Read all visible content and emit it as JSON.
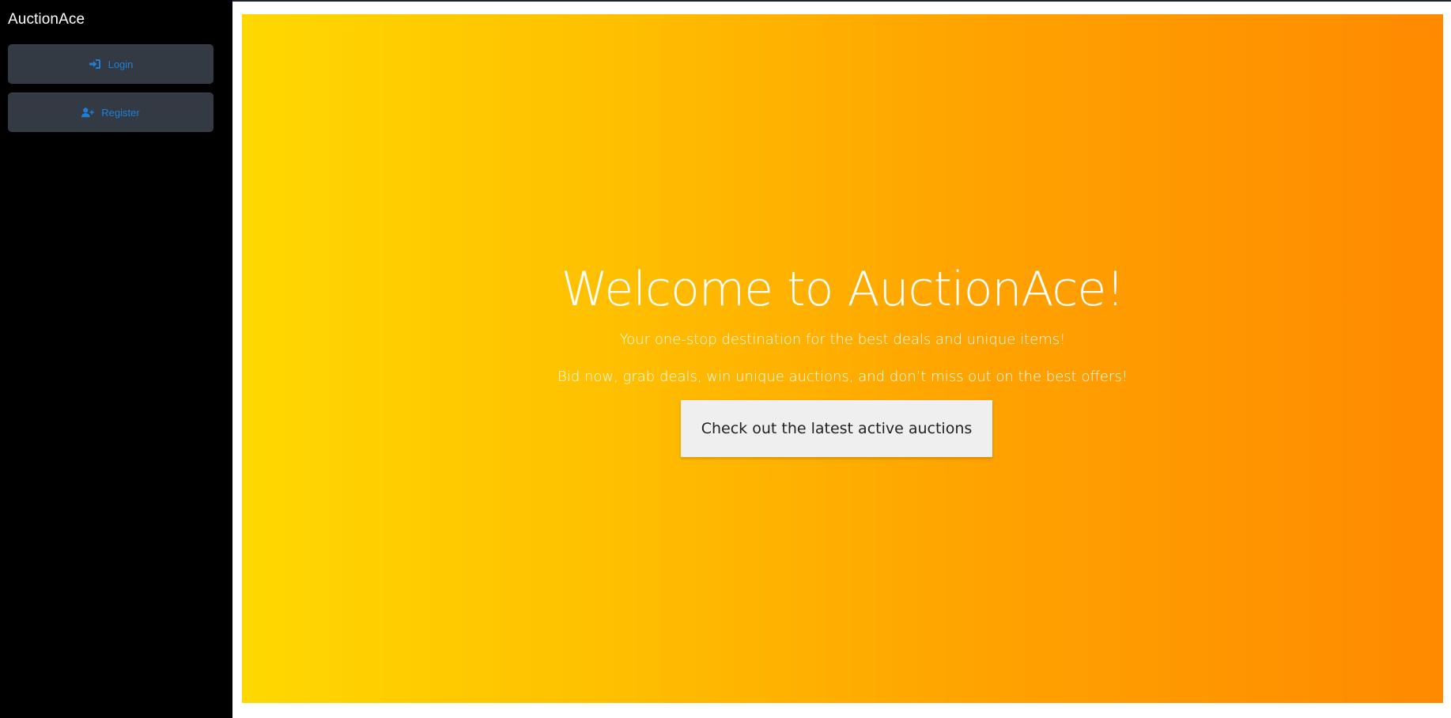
{
  "app": {
    "brand": "AuctionAce"
  },
  "sidebar": {
    "items": [
      {
        "label": "Login",
        "icon": "login-icon"
      },
      {
        "label": "Register",
        "icon": "user-plus-icon"
      }
    ]
  },
  "hero": {
    "title": "Welcome to AuctionAce!",
    "subtitle": "Your one-stop destination for the best deals and unique items!",
    "tagline": "Bid now, grab deals, win unique auctions, and don’t miss out on the best offers!",
    "cta_label": "Check out the latest active auctions"
  },
  "colors": {
    "sidebar_bg": "#000000",
    "nav_button_bg": "#343a44",
    "nav_link": "#1e7fd8",
    "hero_gradient_start": "#ffd800",
    "hero_gradient_end": "#ff8a00",
    "cta_bg": "#efefef"
  }
}
